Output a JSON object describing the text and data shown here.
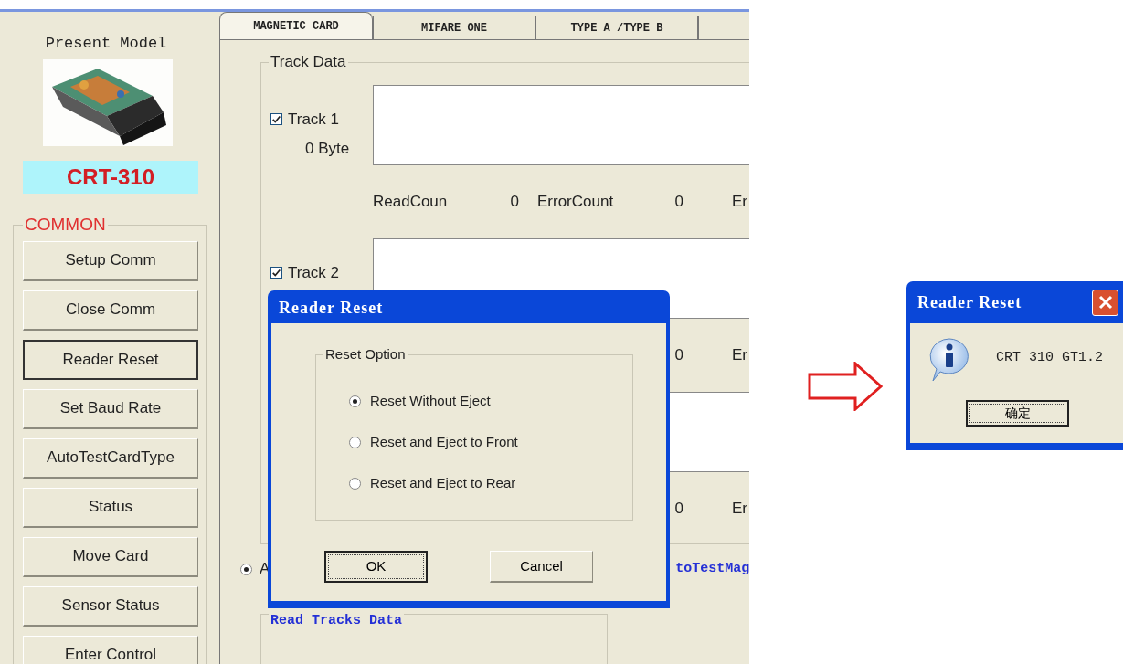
{
  "main_window": {
    "sidebar": {
      "heading": "Present Model",
      "model_name": "CRT-310",
      "group_label": "COMMON",
      "buttons": [
        {
          "label": "Setup Comm",
          "focused": false
        },
        {
          "label": "Close Comm",
          "focused": false
        },
        {
          "label": "Reader Reset",
          "focused": true
        },
        {
          "label": "Set Baud Rate",
          "focused": false
        },
        {
          "label": "AutoTestCardType",
          "focused": false
        },
        {
          "label": "Status",
          "focused": false
        },
        {
          "label": "Move Card",
          "focused": false
        },
        {
          "label": "Sensor Status",
          "focused": false
        },
        {
          "label": "Enter Control",
          "focused": false
        }
      ]
    },
    "tabs": [
      {
        "label": "MAGNETIC CARD",
        "selected": true
      },
      {
        "label": "MIFARE ONE",
        "selected": false
      },
      {
        "label": "TYPE A /TYPE B",
        "selected": false
      },
      {
        "selected": false
      }
    ],
    "track_data": {
      "label": "Track Data",
      "tracks": [
        {
          "label": "Track 1",
          "checked": true,
          "bytes": "0 Byte",
          "read_label": "ReadCoun",
          "read_count": "0",
          "error_label": "ErrorCount",
          "error_count": "0",
          "extra_label": "Er"
        },
        {
          "label": "Track 2",
          "checked": true,
          "error_count": "0",
          "extra_label": "Er"
        },
        {
          "error_count": "0",
          "extra_label": "Er"
        }
      ]
    },
    "mode_radio": {
      "label": "A",
      "selected": true
    },
    "auto_test_label": "toTestMag",
    "read_tracks_label": "Read Tracks Data"
  },
  "dialog": {
    "title": "Reader Reset",
    "group_label": "Reset Option",
    "options": [
      {
        "label": "Reset Without Eject",
        "selected": true
      },
      {
        "label": "Reset and Eject to Front",
        "selected": false
      },
      {
        "label": "Reset and Eject to Rear",
        "selected": false
      }
    ],
    "buttons": [
      {
        "label": "OK",
        "default": true
      },
      {
        "label": "Cancel",
        "default": false
      }
    ]
  },
  "message_box": {
    "title": "Reader Reset",
    "message": "CRT 310 GT1.2",
    "button": "确定"
  }
}
